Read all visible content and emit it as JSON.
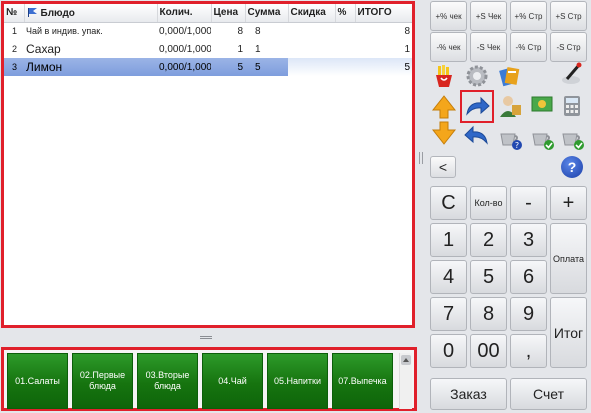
{
  "table": {
    "headers": [
      "№",
      "Блюдо",
      "Колич.",
      "Цена",
      "Сумма",
      "Скидка",
      "%",
      "ИТОГО"
    ],
    "rows": [
      {
        "no": "1",
        "name": "Чай в индив. упак.",
        "qty": "0,000/1,000",
        "price": "8",
        "sum": "8",
        "discount": "",
        "pct": "",
        "total": "8"
      },
      {
        "no": "2",
        "name": "Сахар",
        "qty": "0,000/1,000",
        "price": "1",
        "sum": "1",
        "discount": "",
        "pct": "",
        "total": "1"
      },
      {
        "no": "3",
        "name": "Лимон",
        "qty": "0,000/1,000",
        "price": "5",
        "sum": "5",
        "discount": "",
        "pct": "",
        "total": "5"
      }
    ],
    "selected_row": 3
  },
  "categories": [
    "01.Салаты",
    "02.Первые блюда",
    "03.Вторые блюда",
    "04.Чай",
    "05.Напитки",
    "07.Выпечка"
  ],
  "discount_buttons": {
    "row1": [
      "+% чек",
      "+S Чек",
      "+% Стр",
      "+S Стр"
    ],
    "row2": [
      "-% чек",
      "-S Чек",
      "-% Стр",
      "-S Стр"
    ]
  },
  "icons": [
    "fries-icon",
    "gear-icon",
    "menu-cards-icon",
    "pen-icon",
    "up-down-arrows-icon",
    "redo-arrow-icon",
    "user-icon",
    "money-icon",
    "calculator-icon",
    "undo-arrow-icon",
    "cup-question-icon",
    "cup-check-icon",
    "cup-check-icon"
  ],
  "nav": {
    "back": "<",
    "help": "?"
  },
  "keypad": {
    "clear": "C",
    "qty": "Кол-во",
    "minus": "-",
    "plus": "+",
    "digits": [
      "1",
      "2",
      "3",
      "4",
      "5",
      "6",
      "7",
      "8",
      "9",
      "0",
      "00"
    ],
    "comma": ",",
    "pay": "Оплата",
    "total": "Итог",
    "order": "Заказ",
    "check": "Счет"
  },
  "colors": {
    "highlight": "#e0202b",
    "category_green": "#16740f",
    "selected_row": "#8ea9e2"
  }
}
